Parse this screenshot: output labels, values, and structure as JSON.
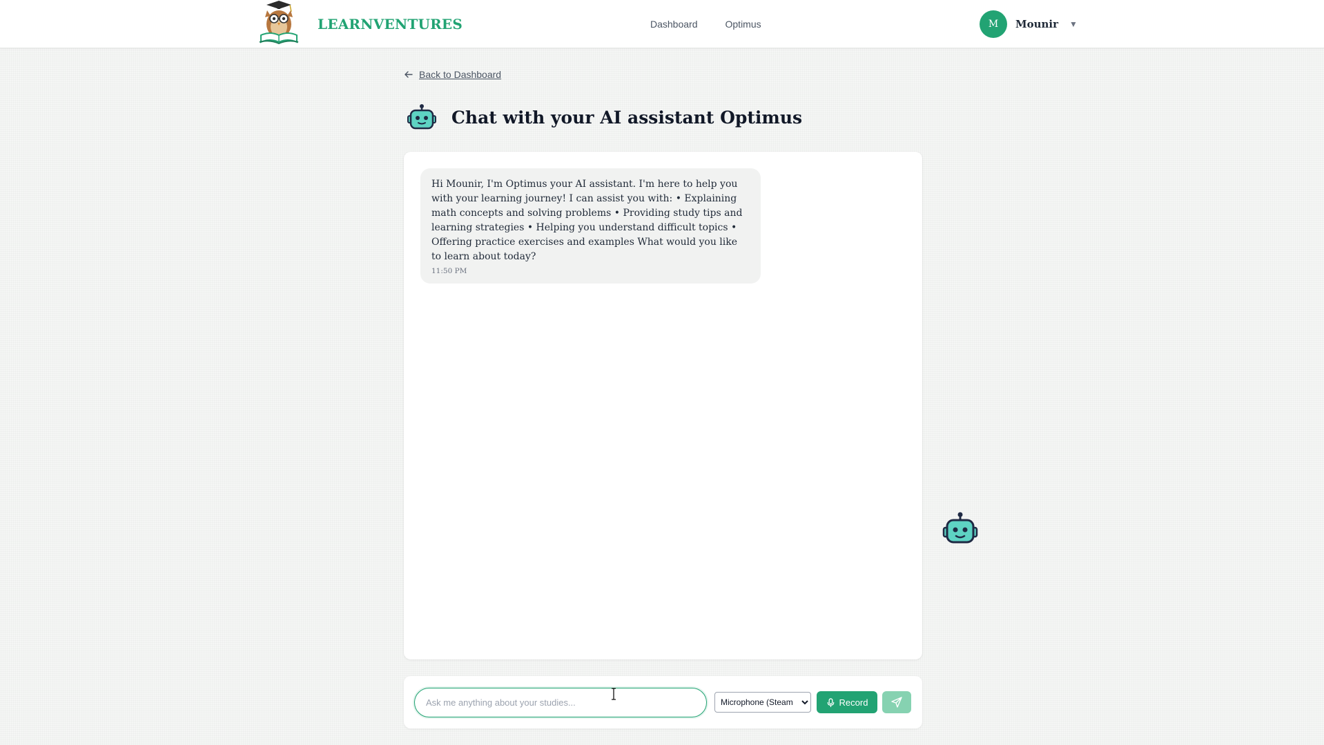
{
  "header": {
    "brand_name": "LEARNVENTURES",
    "nav": [
      {
        "label": "Dashboard"
      },
      {
        "label": "Optimus"
      }
    ],
    "user": {
      "initial": "M",
      "name": "Mounir",
      "caret": "▼"
    }
  },
  "back_link": {
    "label": "Back to Dashboard"
  },
  "page": {
    "title": "Chat with your AI assistant Optimus"
  },
  "messages": [
    {
      "sender": "assistant",
      "text": "Hi Mounir, I'm Optimus your AI assistant. I'm here to help you with your learning journey! I can assist you with: • Explaining math concepts and solving problems • Providing study tips and learning strategies • Helping you understand difficult topics • Offering practice exercises and examples What would you like to learn about today?",
      "time": "11:50 PM"
    }
  ],
  "composer": {
    "placeholder": "Ask me anything about your studies...",
    "value": "",
    "microphone_selected": "Microphone (Steam",
    "record_label": "Record"
  },
  "colors": {
    "accent": "#22a373",
    "accent_light": "#86d2b1",
    "bubble_bg": "#f1f2f1",
    "robot_teal": "#5ed3c3",
    "robot_dark": "#1f2a44"
  },
  "icons": {
    "back": "arrow-left-icon",
    "robot": "robot-icon",
    "mic": "microphone-icon",
    "send": "paper-plane-icon"
  }
}
